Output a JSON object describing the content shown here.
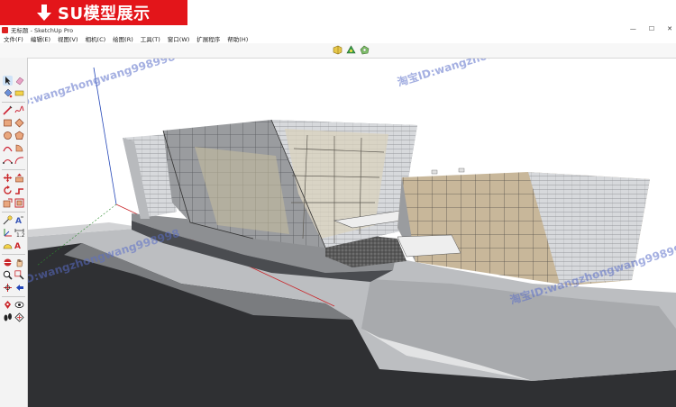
{
  "banner": {
    "text": "SU模型展示",
    "color": "#e3151a"
  },
  "window": {
    "title": "无标题 - SketchUp Pro",
    "controls": [
      "—",
      "☐",
      "✕"
    ]
  },
  "menu": [
    "文件(F)",
    "编辑(E)",
    "视图(V)",
    "相机(C)",
    "绘图(R)",
    "工具(T)",
    "窗口(W)",
    "扩展程序",
    "帮助(H)"
  ],
  "top_tools": [
    "section-plane-icon",
    "display-section-icon",
    "section-fill-icon"
  ],
  "left_tools": [
    "select-icon",
    "eraser-icon",
    "paint-bucket-icon",
    "tape-measure-icon",
    "pencil-line-icon",
    "freehand-icon",
    "rectangle-icon",
    "rotated-rectangle-icon",
    "circle-icon",
    "polygon-icon",
    "arc-icon",
    "pie-icon",
    "2point-arc-icon",
    "3point-arc-icon",
    "move-icon",
    "push-pull-icon",
    "rotate-icon",
    "follow-me-icon",
    "scale-icon",
    "offset-icon",
    "tape-icon",
    "text-icon",
    "axes-icon",
    "dimension-icon",
    "protractor-icon",
    "3d-text-icon",
    "orbit-icon",
    "pan-icon",
    "zoom-icon",
    "zoom-window-icon",
    "zoom-extents-icon",
    "previous-view-icon",
    "position-camera-icon",
    "look-around-icon",
    "walk-icon",
    "section-icon"
  ],
  "watermarks": [
    "淘宝ID:wangzhongwang998998",
    "ID:wangzhongwang998998",
    "淘宝ID:wangzhongwang998998",
    "淘宝ID:wangzhongwang998998"
  ]
}
